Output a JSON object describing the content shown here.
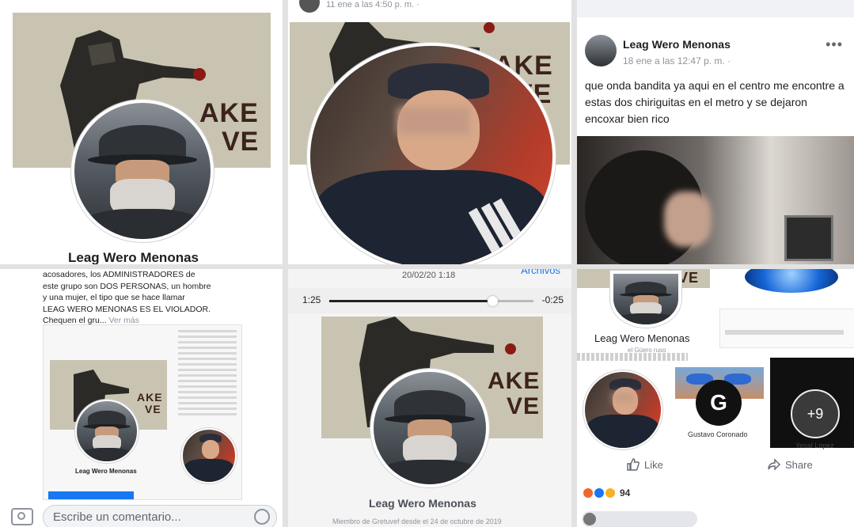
{
  "profile": {
    "name": "Leag Wero Menonas",
    "cover_text_line1": "AKE",
    "cover_text_line2": "VE"
  },
  "panel2": {
    "timestamp": "11 ene a las 4:50 p. m. ·"
  },
  "panel3": {
    "author": "Leag Wero Menonas",
    "timestamp": "18 ene a las 12:47 p. m. ·",
    "post_text": "que onda bandita ya aqui en el centro me encontre a estas dos chiriguitas en el metro y se dejaron encoxar bien rico"
  },
  "panel4": {
    "text_lines": [
      "acosadores, los ADMINISTRADORES  de",
      "este grupo son DOS PERSONAS, un hombre",
      "y una mujer, el tipo que se hace llamar",
      "LEAG WERO MENONAS ES EL VIOLADOR.",
      "Chequen el gru..."
    ],
    "see_more": "Ver más",
    "mini_name": "Leag Wero Menonas",
    "comment_placeholder": "Escribe un comentario..."
  },
  "panel5": {
    "top_date": "20/02/20 1:18",
    "top_right": "Archivos",
    "elapsed": "1:25",
    "remaining": "-0:25",
    "progress": 0.8,
    "name": "Leag Wero Menonas",
    "member_since": "Miembro de Gretuvef desde el 24 de octubre de 2019"
  },
  "panel6": {
    "name": "Leag Wero Menonas",
    "sub": "el Güero ruso",
    "friend1": "Gustavo Coronado",
    "friend1_initial": "G",
    "friend2": "Yesal Lopez",
    "plus": "+9",
    "like_label": "Like",
    "share_label": "Share",
    "reactions_count": "94"
  },
  "colors": {
    "cover_bg": "#c9c4b1",
    "cover_text": "#3d231c",
    "fb_blue": "#1877f2",
    "meta_gray": "#8d949e"
  }
}
